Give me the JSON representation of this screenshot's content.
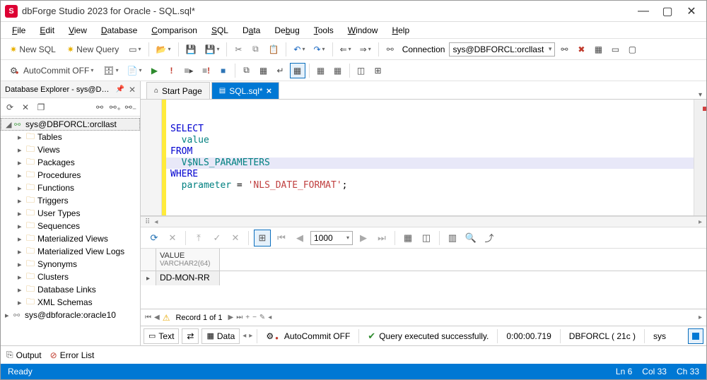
{
  "title": "dbForge Studio 2023 for Oracle - SQL.sql*",
  "app_icon_letter": "S",
  "menu": [
    "File",
    "Edit",
    "View",
    "Database",
    "Comparison",
    "SQL",
    "Data",
    "Debug",
    "Tools",
    "Window",
    "Help"
  ],
  "toolbar1": {
    "new_sql": "New SQL",
    "new_query": "New Query",
    "connection_label": "Connection",
    "connection_value": "sys@DBFORCL:orcllast"
  },
  "toolbar2": {
    "autocommit": "AutoCommit OFF"
  },
  "sidebar": {
    "title": "Database Explorer - sys@DB...",
    "connections": [
      {
        "label": "sys@DBFORCL:orcllast",
        "expanded": true,
        "selected": true,
        "active": true
      },
      {
        "label": "sys@dbforacle:oracle10",
        "expanded": false,
        "selected": false,
        "active": false
      }
    ],
    "folders": [
      "Tables",
      "Views",
      "Packages",
      "Procedures",
      "Functions",
      "Triggers",
      "User Types",
      "Sequences",
      "Materialized Views",
      "Materialized View Logs",
      "Synonyms",
      "Clusters",
      "Database Links",
      "XML Schemas"
    ]
  },
  "tabs": [
    {
      "label": "Start Page",
      "active": false
    },
    {
      "label": "SQL.sql*",
      "active": true
    }
  ],
  "code": {
    "kw_select": "SELECT",
    "val_value": "value",
    "kw_from": "FROM",
    "val_table": "V$NLS_PARAMETERS",
    "kw_where": "WHERE",
    "val_param": "parameter",
    "op_eq": " = ",
    "str_lit": "'NLS_DATE_FORMAT'",
    "semi": ";"
  },
  "grid": {
    "page_size": "1000",
    "col_name": "VALUE",
    "col_type": "VARCHAR2(64)",
    "row_val": "DD-MON-RR",
    "record_text": "Record 1 of 1"
  },
  "status_row": {
    "text_btn": "Text",
    "data_btn": "Data",
    "autocommit": "AutoCommit OFF",
    "exec_msg": "Query executed successfully.",
    "exec_time": "0:00:00.719",
    "db": "DBFORCL ( 21c )",
    "user": "sys"
  },
  "bottom_tabs": {
    "output": "Output",
    "error_list": "Error List"
  },
  "status_bar": {
    "ready": "Ready",
    "ln": "Ln 6",
    "col": "Col 33",
    "ch": "Ch 33"
  }
}
